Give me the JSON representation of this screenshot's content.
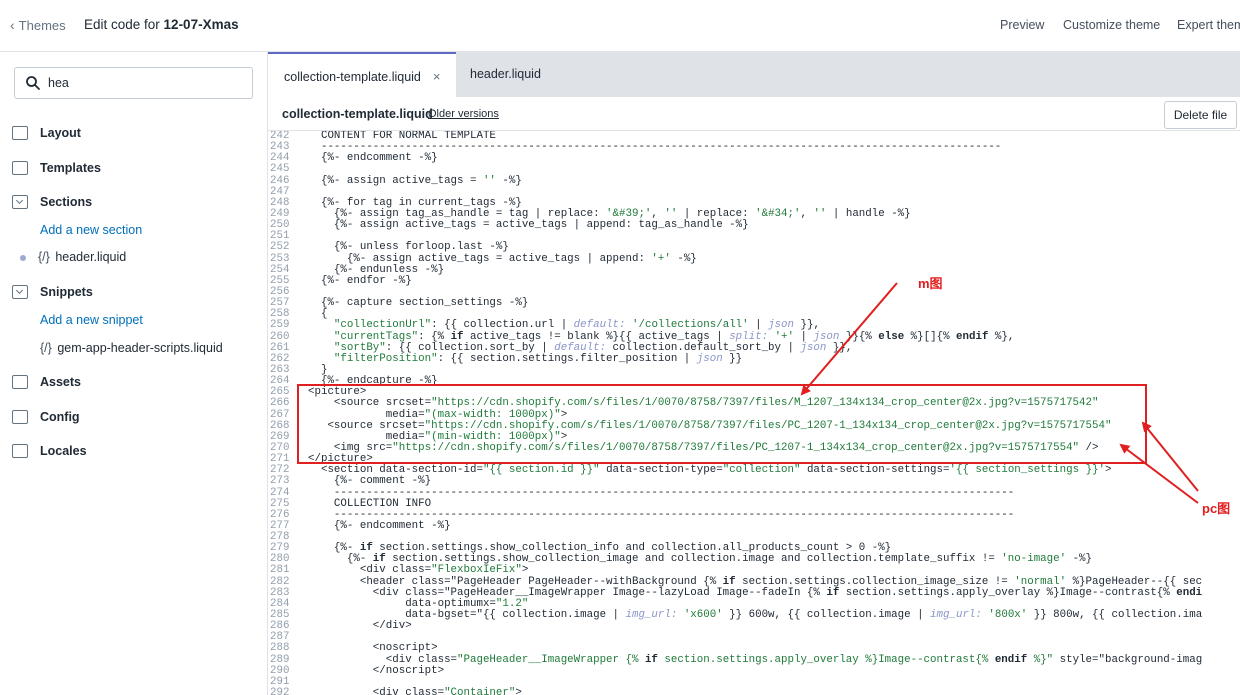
{
  "topbar": {
    "back_label": "Themes",
    "title_prefix": "Edit code for ",
    "theme_name": "12-07-Xmas",
    "nav": [
      "Preview",
      "Customize theme",
      "Expert them"
    ]
  },
  "sidebar": {
    "search_value": "hea",
    "folders": [
      {
        "label": "Layout"
      },
      {
        "label": "Templates"
      },
      {
        "label": "Sections",
        "add_label": "Add a new section",
        "files": [
          "header.liquid"
        ]
      },
      {
        "label": "Snippets",
        "add_label": "Add a new snippet",
        "files": [
          "gem-app-header-scripts.liquid"
        ]
      },
      {
        "label": "Assets"
      },
      {
        "label": "Config"
      },
      {
        "label": "Locales"
      }
    ]
  },
  "tabs": [
    {
      "label": "collection-template.liquid",
      "close": "×"
    },
    {
      "label": "header.liquid"
    }
  ],
  "filebar": {
    "filename": "collection-template.liquid",
    "older_versions": "Older versions",
    "delete_label": "Delete file"
  },
  "code": {
    "lines": [
      {
        "n": "242",
        "t": "  CONTENT FOR NORMAL TEMPLATE"
      },
      {
        "n": "243",
        "t": "  ---------------------------------------------------------------------------------------------------------"
      },
      {
        "n": "244",
        "t": "  {%- endcomment -%}"
      },
      {
        "n": "245",
        "t": ""
      },
      {
        "n": "246",
        "t": "  {%- assign active_tags = '' -%}"
      },
      {
        "n": "247",
        "t": ""
      },
      {
        "n": "248",
        "t": "  {%- for tag in current_tags -%}"
      },
      {
        "n": "249",
        "t": "    {%- assign tag_as_handle = tag | replace: '&#39;', '' | replace: '&#34;', '' | handle -%}"
      },
      {
        "n": "250",
        "t": "    {%- assign active_tags = active_tags | append: tag_as_handle -%}"
      },
      {
        "n": "251",
        "t": ""
      },
      {
        "n": "252",
        "t": "    {%- unless forloop.last -%}"
      },
      {
        "n": "253",
        "t": "      {%- assign active_tags = active_tags | append: '+' -%}"
      },
      {
        "n": "254",
        "t": "    {%- endunless -%}"
      },
      {
        "n": "255",
        "t": "  {%- endfor -%}"
      },
      {
        "n": "256",
        "t": ""
      },
      {
        "n": "257",
        "t": "  {%- capture section_settings -%}"
      },
      {
        "n": "258",
        "t": "  {"
      },
      {
        "n": "259",
        "t": "    \"collectionUrl\": {{ collection.url | default: '/collections/all' | json }},"
      },
      {
        "n": "260",
        "t": "    \"currentTags\": {% if active_tags != blank %}{{ active_tags | split: '+' | json }}{% else %}[]{% endif %},"
      },
      {
        "n": "261",
        "t": "    \"sortBy\": {{ collection.sort_by | default: collection.default_sort_by | json }},"
      },
      {
        "n": "262",
        "t": "    \"filterPosition\": {{ section.settings.filter_position | json }}"
      },
      {
        "n": "263",
        "t": "  }"
      },
      {
        "n": "264",
        "t": "  {%- endcapture -%}"
      },
      {
        "n": "265",
        "t": "<picture>"
      },
      {
        "n": "266",
        "t": "    <source srcset=\"https://cdn.shopify.com/s/files/1/0070/8758/7397/files/M_1207_134x134_crop_center@2x.jpg?v=1575717542\""
      },
      {
        "n": "267",
        "t": "            media=\"(max-width: 1000px)\">"
      },
      {
        "n": "268",
        "t": "   <source srcset=\"https://cdn.shopify.com/s/files/1/0070/8758/7397/files/PC_1207-1_134x134_crop_center@2x.jpg?v=1575717554\""
      },
      {
        "n": "269",
        "t": "            media=\"(min-width: 1000px)\">"
      },
      {
        "n": "270",
        "t": "    <img src=\"https://cdn.shopify.com/s/files/1/0070/8758/7397/files/PC_1207-1_134x134_crop_center@2x.jpg?v=1575717554\" />"
      },
      {
        "n": "271",
        "t": "</picture>"
      },
      {
        "n": "272",
        "t": "  <section data-section-id=\"{{ section.id }}\" data-section-type=\"collection\" data-section-settings='{{ section_settings }}'>"
      },
      {
        "n": "273",
        "t": "    {%- comment -%}"
      },
      {
        "n": "274",
        "t": "    ---------------------------------------------------------------------------------------------------------"
      },
      {
        "n": "275",
        "t": "    COLLECTION INFO"
      },
      {
        "n": "276",
        "t": "    ---------------------------------------------------------------------------------------------------------"
      },
      {
        "n": "277",
        "t": "    {%- endcomment -%}"
      },
      {
        "n": "278",
        "t": ""
      },
      {
        "n": "279",
        "t": "    {%- if section.settings.show_collection_info and collection.all_products_count > 0 -%}"
      },
      {
        "n": "280",
        "t": "      {%- if section.settings.show_collection_image and collection.image and collection.template_suffix != 'no-image' -%}"
      },
      {
        "n": "281",
        "t": "        <div class=\"FlexboxIeFix\">"
      },
      {
        "n": "282",
        "t": "        <header class=\"PageHeader PageHeader--withBackground {% if section.settings.collection_image_size != 'normal' %}PageHeader--{{ sec"
      },
      {
        "n": "283",
        "t": "          <div class=\"PageHeader__ImageWrapper Image--lazyLoad Image--fadeIn {% if section.settings.apply_overlay %}Image--contrast{% endi"
      },
      {
        "n": "284",
        "t": "               data-optimumx=\"1.2\""
      },
      {
        "n": "285",
        "t": "               data-bgset=\"{{ collection.image | img_url: 'x600' }} 600w, {{ collection.image | img_url: '800x' }} 800w, {{ collection.ima"
      },
      {
        "n": "286",
        "t": "          </div>"
      },
      {
        "n": "287",
        "t": ""
      },
      {
        "n": "288",
        "t": "          <noscript>"
      },
      {
        "n": "289",
        "t": "            <div class=\"PageHeader__ImageWrapper {% if section.settings.apply_overlay %}Image--contrast{% endif %}\" style=\"background-imag"
      },
      {
        "n": "290",
        "t": "          </noscript>"
      },
      {
        "n": "291",
        "t": ""
      },
      {
        "n": "292",
        "t": "          <div class=\"Container\">"
      }
    ]
  },
  "annotations": {
    "m_label": "m图",
    "pc_label": "pc图",
    "color": "#e02020"
  }
}
